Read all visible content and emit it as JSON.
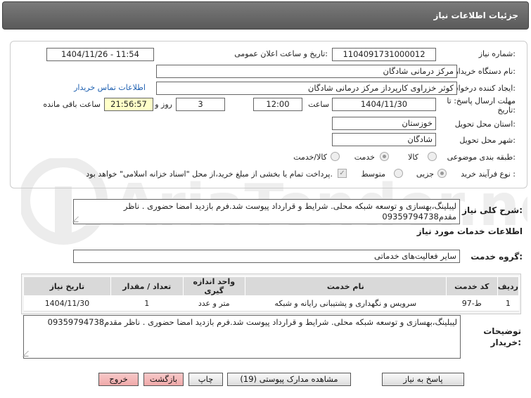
{
  "header": {
    "title": "جزئیات اطلاعات نیاز"
  },
  "form": {
    "need_number_label": "شماره نیاز:",
    "need_number": "1104091731000012",
    "announce_label": "تاریخ و ساعت اعلان عمومی:",
    "announce_value": "1404/11/26 - 11:54",
    "buyer_org_label": "نام دستگاه خریدار:",
    "buyer_org": "مرکز درمانی شادگان",
    "requester_label": "ایجاد کننده درخواست:",
    "requester": "کوثر خزراوی کارپرداز مرکز درمانی شادگان",
    "contact_link": "اطلاعات تماس خریدار",
    "deadline_label_1": "مهلت ارسال پاسخ: تا",
    "deadline_label_2": "تاریخ:",
    "deadline_date": "1404/11/30",
    "time_label": "ساعت",
    "deadline_time": "12:00",
    "days_value": "3",
    "days_label": "روز و",
    "remaining_time": "21:56:57",
    "remaining_label": "ساعت باقی مانده",
    "province_label": "استان محل تحویل:",
    "province": "خوزستان",
    "city_label": "شهر محل تحویل:",
    "city": "شادگان",
    "category_label": "طبقه بندی موضوعی:",
    "category_options": [
      "کالا",
      "خدمت",
      "کالا/خدمت"
    ],
    "category_selected": "خدمت",
    "process_label": "نوع فرآیند خرید :",
    "process_options": [
      "جزیی",
      "متوسط"
    ],
    "process_selected": "جزیی",
    "payment_note": "پرداخت تمام یا بخشی از مبلغ خرید،از محل \"اسناد خزانه اسلامی\" خواهد بود."
  },
  "summary": {
    "label": "شرح کلی نیاز:",
    "line1": "لیبلینگ،بهسازی  و توسعه شبکه محلی. شرایط و قرارداد پیوست شد.فرم بازدید امضا حضوری . ناظر",
    "line2": "مقدم09359794738"
  },
  "services": {
    "section_title": "اطلاعات خدمات مورد نیاز",
    "group_label": "گروه خدمت:",
    "group_value": "سایر فعالیت‌های خدماتی",
    "columns": [
      "ردیف",
      "کد خدمت",
      "نام خدمت",
      "واحد اندازه گیری",
      "تعداد / مقدار",
      "تاریخ نیاز"
    ],
    "rows": [
      [
        "1",
        "ط-97",
        "سرویس و نگهداری و پشتیبانی رایانه و شبکه",
        "متر و عدد",
        "1",
        "1404/11/30"
      ]
    ]
  },
  "buyer_notes": {
    "label_1": "توضیحات",
    "label_2": "خریدار:",
    "text": "لیبلینگ،بهسازی  و توسعه شبکه محلی. شرایط و قرارداد پیوست شد.فرم بازدید امضا حضوری . ناظر مقدم09359794738"
  },
  "buttons": {
    "reply": "پاسخ به نیاز",
    "docs": "مشاهده مدارک پیوستی (19)",
    "print": "چاپ",
    "back": "بازگشت",
    "exit": "خروج"
  },
  "watermark": {
    "text": "AriaTender.net"
  },
  "colors": {
    "header_bg": "#666666",
    "link": "#1d5fb0",
    "highlight": "#ffffc8",
    "danger_btn": "#f0a9a9"
  }
}
